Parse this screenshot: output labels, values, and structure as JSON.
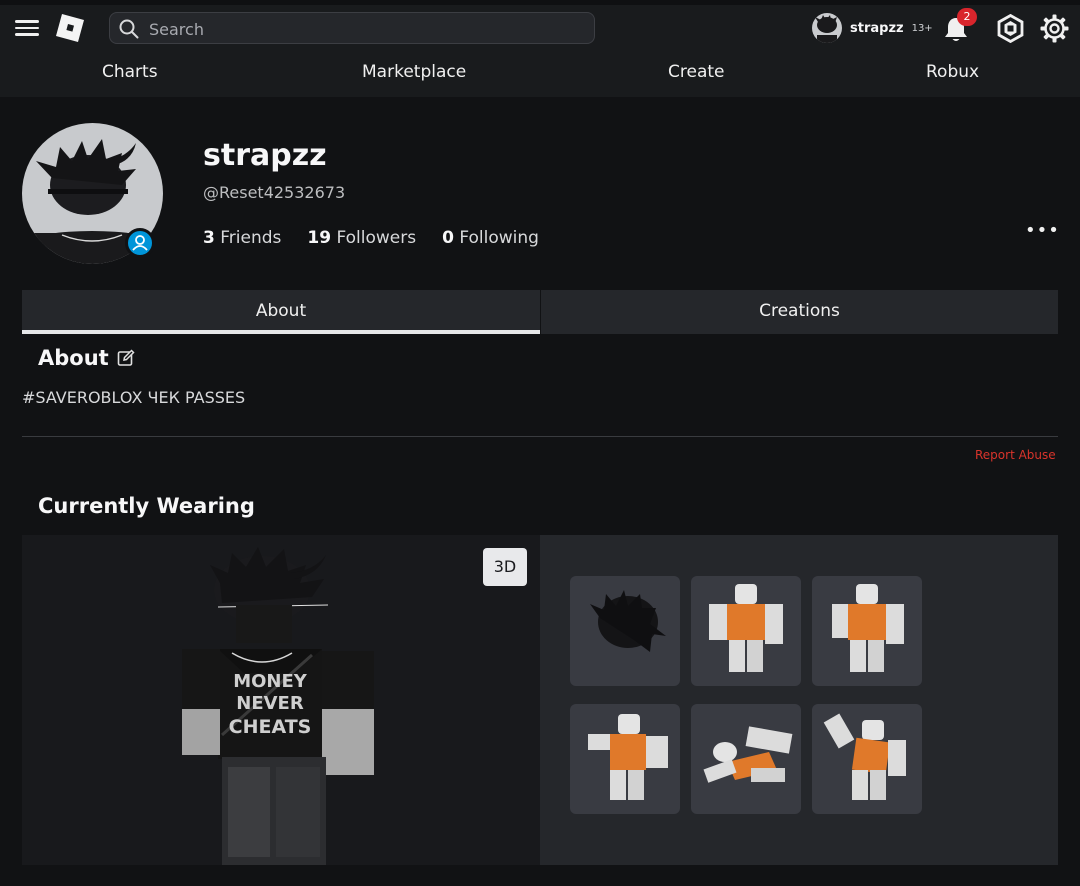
{
  "header": {
    "search_placeholder": "Search",
    "user": {
      "name": "strapzz",
      "age_badge": "13+"
    },
    "notifications_count": "2",
    "nav": [
      "Charts",
      "Marketplace",
      "Create",
      "Robux"
    ],
    "icons": [
      "menu-icon",
      "roblox-logo-icon",
      "search-icon",
      "bell-icon",
      "robux-icon",
      "gear-icon"
    ]
  },
  "profile": {
    "display_name": "strapzz",
    "username": "@Reset42532673",
    "stats": [
      {
        "count": "3",
        "label": "Friends"
      },
      {
        "count": "19",
        "label": "Followers"
      },
      {
        "count": "0",
        "label": "Following"
      }
    ],
    "more_label": "•••"
  },
  "tabs": {
    "about": "About",
    "creations": "Creations"
  },
  "about": {
    "heading": "About",
    "text": "#SAVEROBLOX ЧЕК PASSES",
    "report_abuse": "Report Abuse"
  },
  "wearing": {
    "heading": "Currently Wearing",
    "view_3d_label": "3D",
    "items": [
      "hair accessory",
      "animation pose",
      "animation pose",
      "animation pose",
      "animation pose",
      "animation pose"
    ]
  },
  "colors": {
    "background": "#111214",
    "header": "#191b1d",
    "panel": "#25272b",
    "item_card": "#393b42",
    "accent_blue": "#0095d9",
    "report_red": "#d9342b",
    "badge_red": "#d9252c"
  }
}
